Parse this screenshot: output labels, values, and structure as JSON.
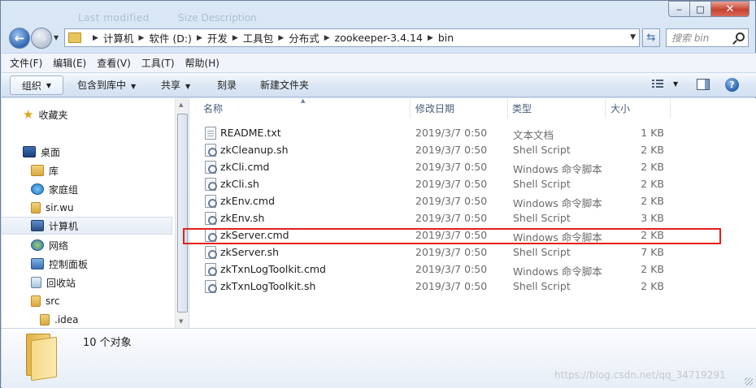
{
  "titlebar": {
    "ghost_text_1": "Last modified",
    "ghost_text_2": "Size   Description",
    "min": "‒",
    "max": "□",
    "close": "✕"
  },
  "address": {
    "crumbs": [
      "计算机",
      "软件 (D:)",
      "开发",
      "工具包",
      "分布式",
      "zookeeper-3.4.14",
      "bin"
    ]
  },
  "search": {
    "placeholder": "搜索 bin"
  },
  "menubar": {
    "items": [
      "文件(F)",
      "编辑(E)",
      "查看(V)",
      "工具(T)",
      "帮助(H)"
    ]
  },
  "toolbar": {
    "organize": "组织",
    "include_library": "包含到库中",
    "share": "共享",
    "burn": "刻录",
    "new_folder": "新建文件夹"
  },
  "navpane": {
    "items": [
      {
        "label": "收藏夹",
        "icon": "favorites-star-icon"
      },
      {
        "label": "桌面",
        "icon": "desktop-icon"
      },
      {
        "label": "库",
        "icon": "library-icon"
      },
      {
        "label": "家庭组",
        "icon": "homegroup-icon"
      },
      {
        "label": "sir.wu",
        "icon": "user-folder-icon"
      },
      {
        "label": "计算机",
        "icon": "computer-icon"
      },
      {
        "label": "网络",
        "icon": "network-icon"
      },
      {
        "label": "控制面板",
        "icon": "control-panel-icon"
      },
      {
        "label": "回收站",
        "icon": "recycle-bin-icon"
      },
      {
        "label": "src",
        "icon": "folder-icon"
      },
      {
        "label": ".idea",
        "icon": "folder-icon"
      }
    ],
    "selected": "计算机"
  },
  "columns": {
    "name": "名称",
    "date": "修改日期",
    "type": "类型",
    "size": "大小"
  },
  "files": [
    {
      "name": "README.txt",
      "date": "2019/3/7 0:50",
      "type": "文本文档",
      "size": "1 KB",
      "kind": "txt"
    },
    {
      "name": "zkCleanup.sh",
      "date": "2019/3/7 0:50",
      "type": "Shell Script",
      "size": "2 KB",
      "kind": "script"
    },
    {
      "name": "zkCli.cmd",
      "date": "2019/3/7 0:50",
      "type": "Windows 命令脚本",
      "size": "2 KB",
      "kind": "script"
    },
    {
      "name": "zkCli.sh",
      "date": "2019/3/7 0:50",
      "type": "Shell Script",
      "size": "2 KB",
      "kind": "script"
    },
    {
      "name": "zkEnv.cmd",
      "date": "2019/3/7 0:50",
      "type": "Windows 命令脚本",
      "size": "2 KB",
      "kind": "script"
    },
    {
      "name": "zkEnv.sh",
      "date": "2019/3/7 0:50",
      "type": "Shell Script",
      "size": "3 KB",
      "kind": "script"
    },
    {
      "name": "zkServer.cmd",
      "date": "2019/3/7 0:50",
      "type": "Windows 命令脚本",
      "size": "2 KB",
      "kind": "script"
    },
    {
      "name": "zkServer.sh",
      "date": "2019/3/7 0:50",
      "type": "Shell Script",
      "size": "7 KB",
      "kind": "script"
    },
    {
      "name": "zkTxnLogToolkit.cmd",
      "date": "2019/3/7 0:50",
      "type": "Windows 命令脚本",
      "size": "2 KB",
      "kind": "script"
    },
    {
      "name": "zkTxnLogToolkit.sh",
      "date": "2019/3/7 0:50",
      "type": "Shell Script",
      "size": "2 KB",
      "kind": "script"
    }
  ],
  "highlighted_file": "zkServer.cmd",
  "details": {
    "object_count": "10 个对象",
    "watermark": "https://blog.csdn.net/qq_34719291"
  },
  "colors": {
    "highlight_border": "#e3201b",
    "selection_bg": "#e5ecf5"
  }
}
